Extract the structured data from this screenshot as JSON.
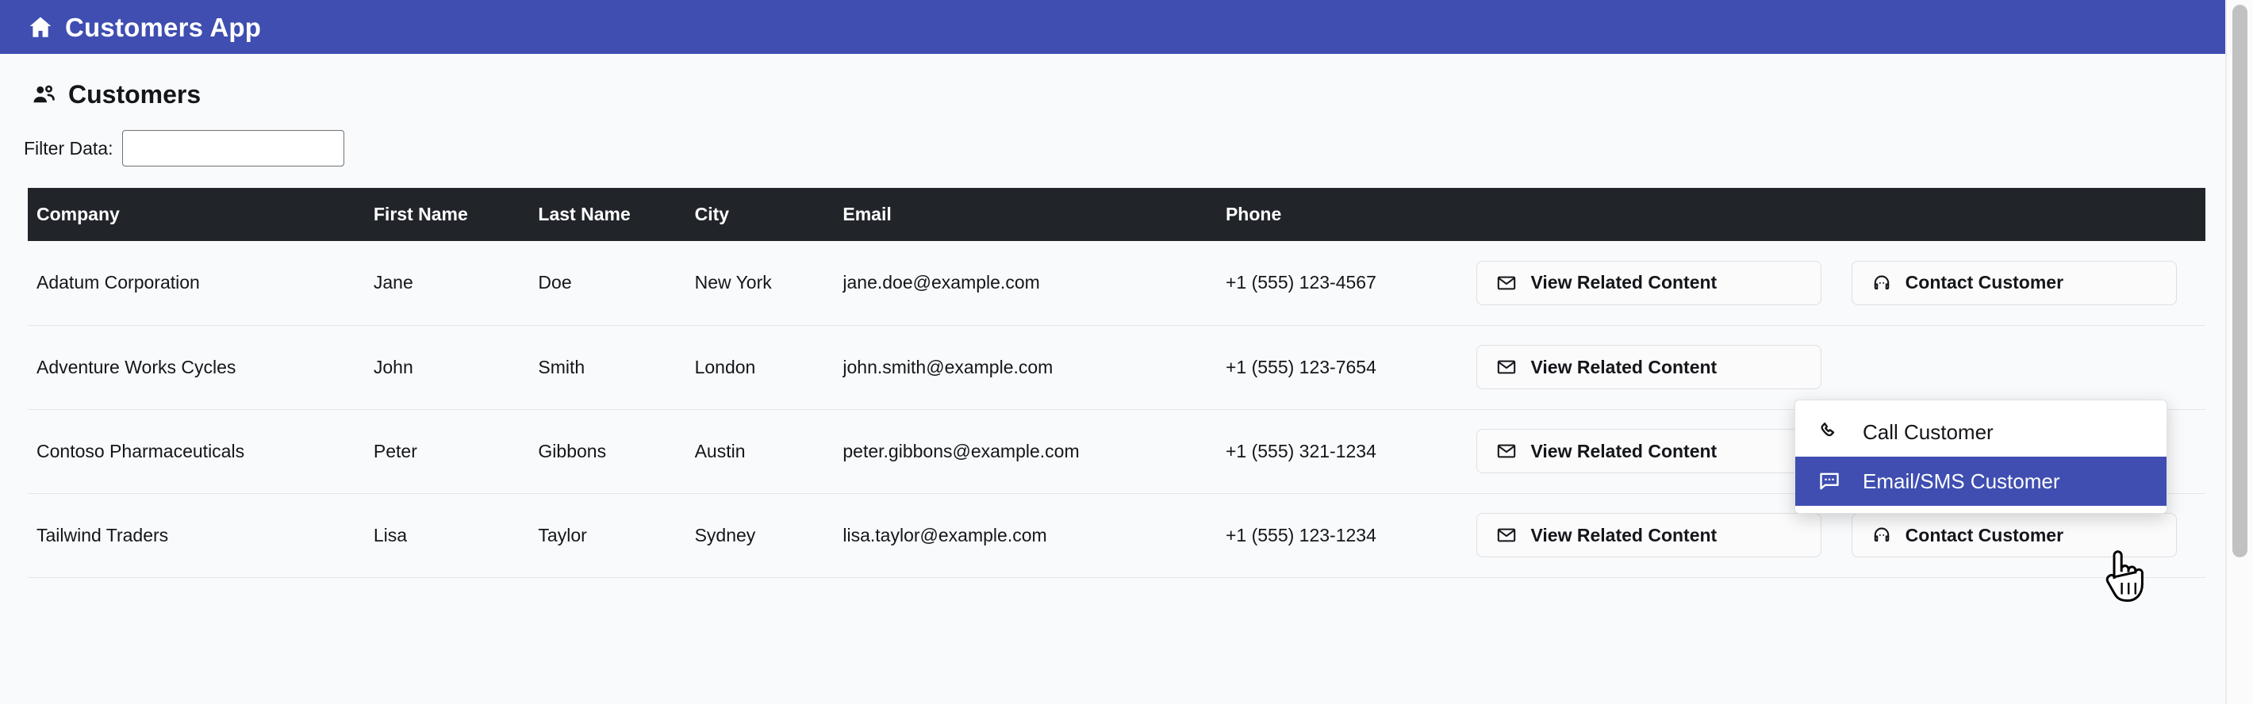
{
  "appbar": {
    "home_icon": "home-icon",
    "title": "Customers App",
    "background_color": "#3f4eb0",
    "text_color": "#ffffff"
  },
  "section": {
    "people_icon": "people-group-icon",
    "title": "Customers"
  },
  "filter": {
    "label": "Filter Data:",
    "value": "",
    "placeholder": ""
  },
  "table": {
    "columns": [
      "Company",
      "First Name",
      "Last Name",
      "City",
      "Email",
      "Phone"
    ],
    "header_background": "#212529",
    "header_text_color": "#ffffff",
    "action_buttons": {
      "view_related": {
        "label": "View Related Content",
        "icon": "envelope-icon"
      },
      "contact": {
        "label": "Contact Customer",
        "icon": "headset-icon"
      }
    },
    "rows": [
      {
        "company": "Adatum Corporation",
        "first_name": "Jane",
        "last_name": "Doe",
        "city": "New York",
        "email": "jane.doe@example.com",
        "phone": "+1 (555) 123-4567"
      },
      {
        "company": "Adventure Works Cycles",
        "first_name": "John",
        "last_name": "Smith",
        "city": "London",
        "email": "john.smith@example.com",
        "phone": "+1 (555) 123-7654"
      },
      {
        "company": "Contoso Pharmaceuticals",
        "first_name": "Peter",
        "last_name": "Gibbons",
        "city": "Austin",
        "email": "peter.gibbons@example.com",
        "phone": "+1 (555) 321-1234"
      },
      {
        "company": "Tailwind Traders",
        "first_name": "Lisa",
        "last_name": "Taylor",
        "city": "Sydney",
        "email": "lisa.taylor@example.com",
        "phone": "+1 (555) 123-1234"
      }
    ]
  },
  "contact_menu": {
    "open_for_row": 0,
    "highlight_color": "#3f4eb0",
    "items": [
      {
        "label": "Call Customer",
        "icon": "phone-icon",
        "highlighted": false
      },
      {
        "label": "Email/SMS Customer",
        "icon": "chat-bubble-dots-icon",
        "highlighted": true
      }
    ]
  },
  "cursor": {
    "type": "pointer-hand-cursor"
  },
  "scrollbar": {
    "orientation": "vertical",
    "thumb_color": "#c1c1c1"
  }
}
